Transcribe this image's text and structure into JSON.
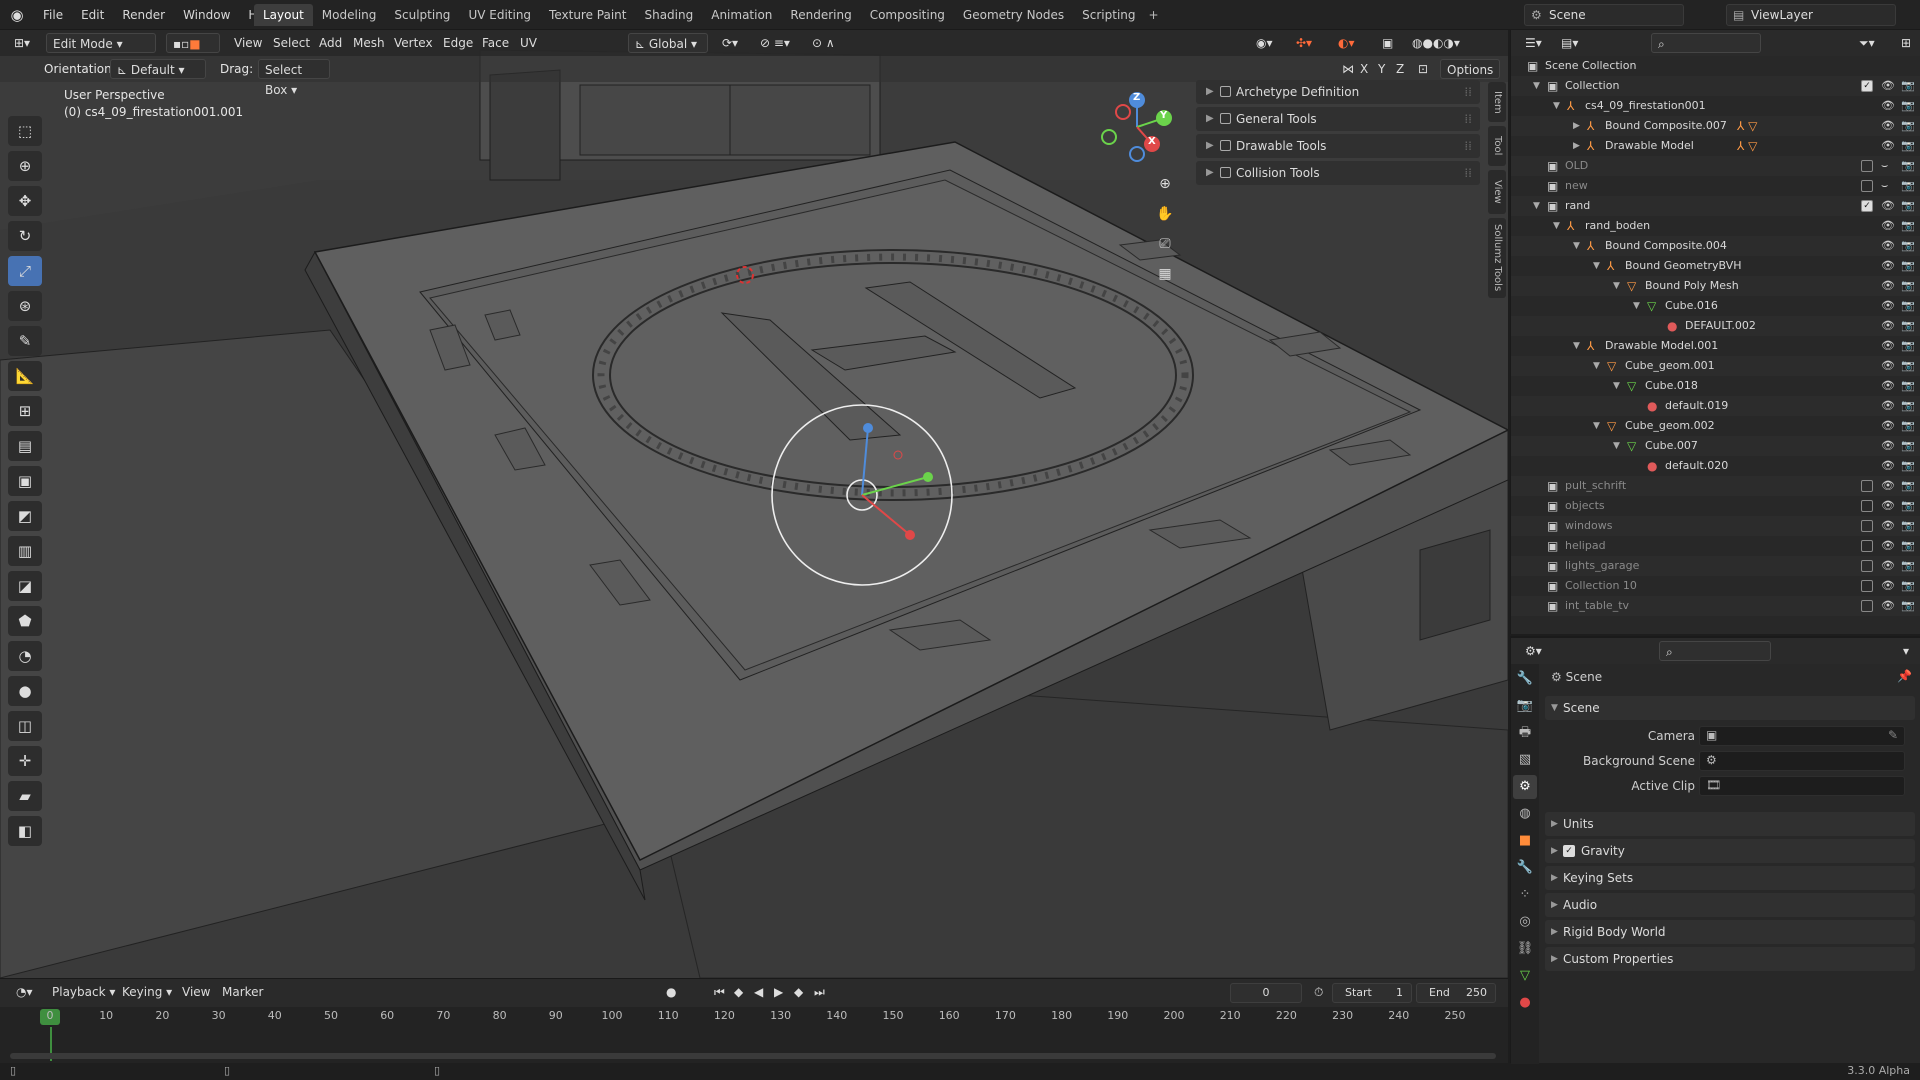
{
  "menu": [
    "File",
    "Edit",
    "Render",
    "Window",
    "Help"
  ],
  "workspaces": [
    "Layout",
    "Modeling",
    "Sculpting",
    "UV Editing",
    "Texture Paint",
    "Shading",
    "Animation",
    "Rendering",
    "Compositing",
    "Geometry Nodes",
    "Scripting"
  ],
  "active_workspace": "Layout",
  "scene_name": "Scene",
  "view_layer": "ViewLayer",
  "viewport": {
    "mode": "Edit Mode",
    "menus": [
      "View",
      "Select",
      "Add",
      "Mesh",
      "Vertex",
      "Edge",
      "Face",
      "UV"
    ],
    "transform_orientation": "Global",
    "orientation_label": "Orientation:",
    "orientation_value": "Default",
    "drag_label": "Drag:",
    "drag_value": "Select Box",
    "options_label": "Options",
    "axis_x": "X",
    "axis_y": "Y",
    "axis_z": "Z",
    "overlay_title": "User Perspective",
    "overlay_object": "(0) cs4_09_firestation001.001",
    "npanels": [
      "Archetype Definition",
      "General Tools",
      "Drawable Tools",
      "Collision Tools"
    ],
    "side_tabs": [
      "Item",
      "Tool",
      "View",
      "Sollumz Tools"
    ],
    "gizmo": {
      "x": "X",
      "y": "Y",
      "z": "Z"
    }
  },
  "timeline": {
    "menus": [
      "Playback",
      "Keying",
      "View",
      "Marker"
    ],
    "current_frame": "0",
    "start_label": "Start",
    "start": "1",
    "end_label": "End",
    "end": "250",
    "ticks": [
      "0",
      "10",
      "20",
      "30",
      "40",
      "50",
      "60",
      "70",
      "80",
      "90",
      "100",
      "110",
      "120",
      "130",
      "140",
      "150",
      "160",
      "170",
      "180",
      "190",
      "200",
      "210",
      "220",
      "230",
      "240",
      "250"
    ]
  },
  "status": {
    "version": "3.3.0 Alpha"
  },
  "outliner": {
    "rows": [
      {
        "label": "Scene Collection",
        "indent": 0,
        "icon": "collection",
        "arrow": ""
      },
      {
        "label": "Collection",
        "indent": 1,
        "icon": "collection",
        "arrow": "▼",
        "check": true
      },
      {
        "label": "cs4_09_firestation001",
        "indent": 2,
        "icon": "empty",
        "arrow": "▼"
      },
      {
        "label": "Bound Composite.007",
        "indent": 3,
        "icon": "empty",
        "arrow": "▶",
        "extra": "orange"
      },
      {
        "label": "Drawable Model",
        "indent": 3,
        "icon": "empty",
        "arrow": "▶",
        "extra": "orange"
      },
      {
        "label": "OLD",
        "indent": 1,
        "icon": "collection",
        "arrow": "",
        "dim": true,
        "check": false
      },
      {
        "label": "new",
        "indent": 1,
        "icon": "collection",
        "arrow": "",
        "dim": true,
        "check": false
      },
      {
        "label": "rand",
        "indent": 1,
        "icon": "collection",
        "arrow": "▼",
        "check": true
      },
      {
        "label": "rand_boden",
        "indent": 2,
        "icon": "empty",
        "arrow": "▼"
      },
      {
        "label": "Bound Composite.004",
        "indent": 3,
        "icon": "empty",
        "arrow": "▼"
      },
      {
        "label": "Bound GeometryBVH",
        "indent": 4,
        "icon": "empty",
        "arrow": "▼"
      },
      {
        "label": "Bound Poly Mesh",
        "indent": 5,
        "icon": "mesh",
        "arrow": "▼"
      },
      {
        "label": "Cube.016",
        "indent": 6,
        "icon": "meshdata",
        "arrow": "▼"
      },
      {
        "label": "DEFAULT.002",
        "indent": 7,
        "icon": "material",
        "arrow": ""
      },
      {
        "label": "Drawable Model.001",
        "indent": 3,
        "icon": "empty",
        "arrow": "▼"
      },
      {
        "label": "Cube_geom.001",
        "indent": 4,
        "icon": "mesh",
        "arrow": "▼"
      },
      {
        "label": "Cube.018",
        "indent": 5,
        "icon": "meshdata",
        "arrow": "▼"
      },
      {
        "label": "default.019",
        "indent": 6,
        "icon": "material",
        "arrow": ""
      },
      {
        "label": "Cube_geom.002",
        "indent": 4,
        "icon": "mesh",
        "arrow": "▼"
      },
      {
        "label": "Cube.007",
        "indent": 5,
        "icon": "meshdata",
        "arrow": "▼"
      },
      {
        "label": "default.020",
        "indent": 6,
        "icon": "material",
        "arrow": ""
      },
      {
        "label": "pult_schrift",
        "indent": 1,
        "icon": "collection",
        "arrow": "",
        "dim": true,
        "check": false
      },
      {
        "label": "objects",
        "indent": 1,
        "icon": "collection",
        "arrow": "",
        "dim": true,
        "check": false
      },
      {
        "label": "windows",
        "indent": 1,
        "icon": "collection",
        "arrow": "",
        "dim": true,
        "check": false
      },
      {
        "label": "helipad",
        "indent": 1,
        "icon": "collection",
        "arrow": "",
        "dim": true,
        "check": false
      },
      {
        "label": "lights_garage",
        "indent": 1,
        "icon": "collection",
        "arrow": "",
        "dim": true,
        "check": false
      },
      {
        "label": "Collection 10",
        "indent": 1,
        "icon": "collection",
        "arrow": "",
        "dim": true,
        "check": false
      },
      {
        "label": "int_table_tv",
        "indent": 1,
        "icon": "collection",
        "arrow": "",
        "dim": true,
        "check": false
      }
    ]
  },
  "properties": {
    "context": "Scene",
    "panel": "Scene",
    "fields": [
      {
        "label": "Camera"
      },
      {
        "label": "Background Scene"
      },
      {
        "label": "Active Clip"
      }
    ],
    "sections": [
      "Units",
      "Gravity",
      "Keying Sets",
      "Audio",
      "Rigid Body World",
      "Custom Properties"
    ]
  }
}
